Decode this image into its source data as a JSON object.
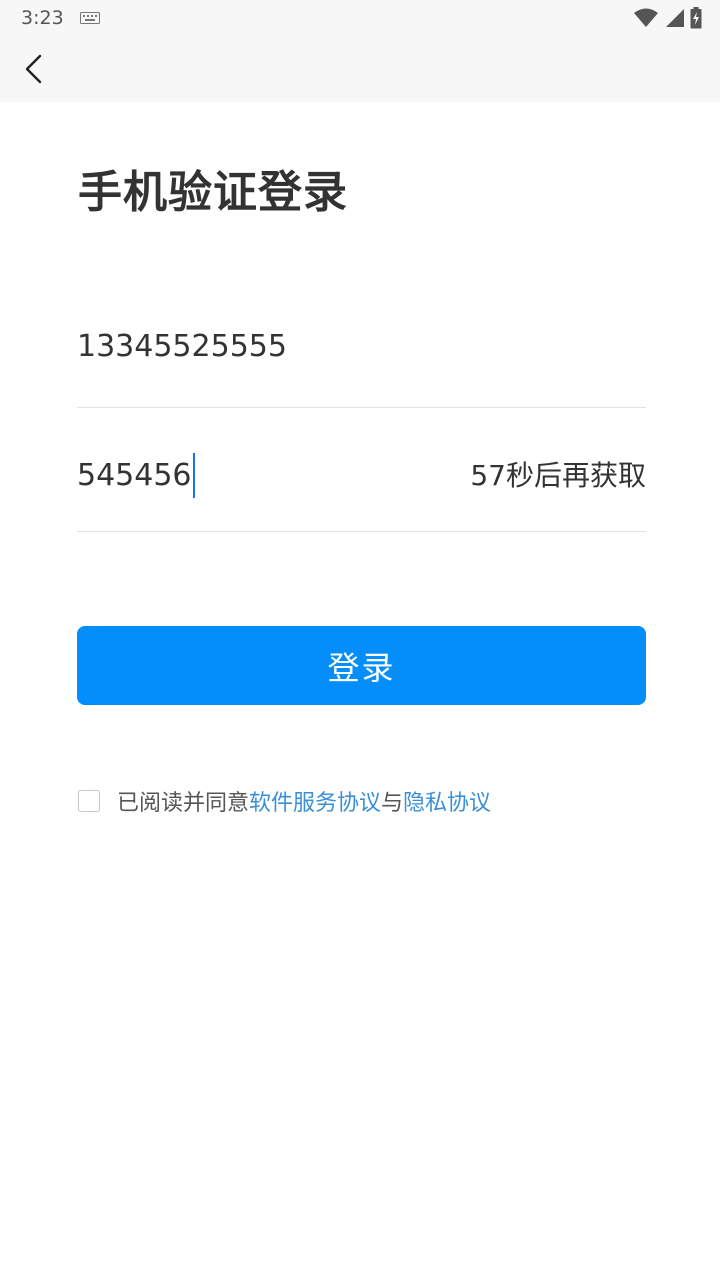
{
  "status_bar": {
    "time": "3:23",
    "icons": [
      "keyboard-icon",
      "wifi-icon",
      "signal-icon",
      "battery-charging-icon"
    ]
  },
  "nav": {
    "back_icon": "chevron-left-icon"
  },
  "page": {
    "title": "手机验证登录"
  },
  "form": {
    "phone_value": "13345525555",
    "code_value": "545456",
    "resend_label": "57秒后再获取"
  },
  "login_button": {
    "label": "登录"
  },
  "agreement": {
    "prefix": "已阅读并同意",
    "service_link": "软件服务协议",
    "joiner": "与",
    "privacy_link": "隐私协议",
    "checked": false
  },
  "colors": {
    "accent": "#038efc",
    "link": "#3b8fd6",
    "bar_bg": "#f7f7f7"
  }
}
